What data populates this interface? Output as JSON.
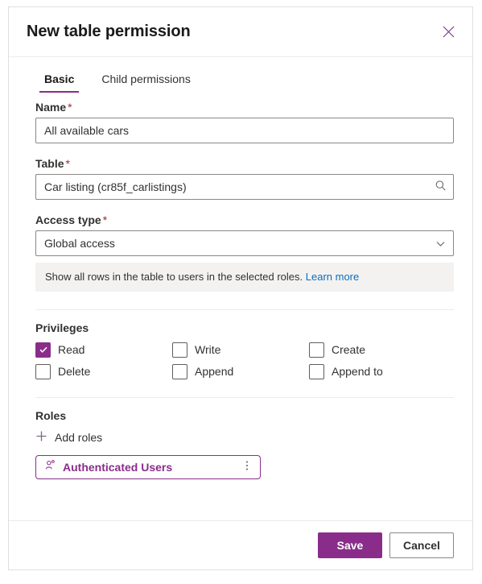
{
  "dialog": {
    "title": "New table permission",
    "close_icon": "close-icon"
  },
  "tabs": [
    {
      "label": "Basic",
      "active": true
    },
    {
      "label": "Child permissions",
      "active": false
    }
  ],
  "fields": {
    "name": {
      "label": "Name",
      "required_marker": "*",
      "value": "All available cars",
      "placeholder": ""
    },
    "table": {
      "label": "Table",
      "required_marker": "*",
      "value": "Car listing (cr85f_carlistings)",
      "placeholder": "",
      "icon": "search-icon"
    },
    "access_type": {
      "label": "Access type",
      "required_marker": "*",
      "value": "Global access",
      "options": [
        "Global access"
      ],
      "icon": "chevron-down-icon"
    }
  },
  "info_banner": {
    "text": "Show all rows in the table to users in the selected roles.",
    "link_label": "Learn more"
  },
  "privileges": {
    "title": "Privileges",
    "items": [
      {
        "label": "Read",
        "checked": true
      },
      {
        "label": "Write",
        "checked": false
      },
      {
        "label": "Create",
        "checked": false
      },
      {
        "label": "Delete",
        "checked": false
      },
      {
        "label": "Append",
        "checked": false
      },
      {
        "label": "Append to",
        "checked": false
      }
    ]
  },
  "roles": {
    "title": "Roles",
    "add_label": "Add roles",
    "add_icon": "plus-icon",
    "chips": [
      {
        "label": "Authenticated Users",
        "icon": "person-icon",
        "more_icon": "more-vertical-icon"
      }
    ]
  },
  "footer": {
    "save_label": "Save",
    "cancel_label": "Cancel"
  },
  "colors": {
    "accent": "#8a2d8a",
    "link": "#0f6cbd",
    "required": "#a4262c",
    "banner_bg": "#f3f2f1"
  }
}
